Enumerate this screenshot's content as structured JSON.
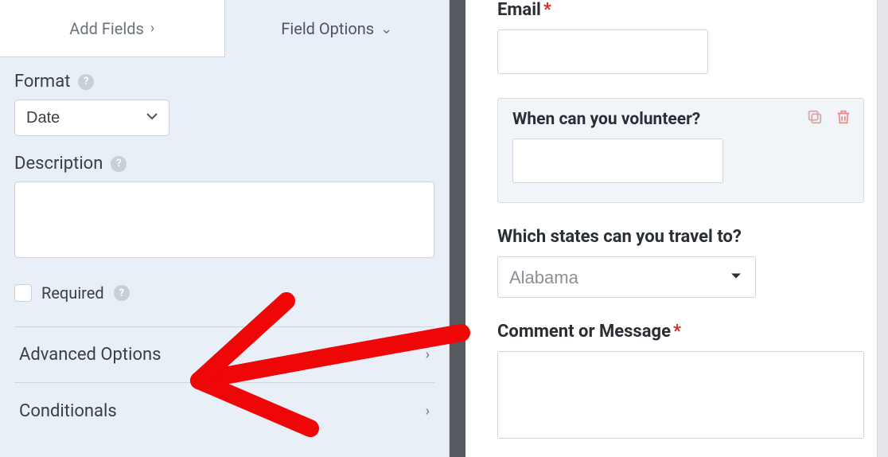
{
  "tabs": {
    "add_fields": "Add Fields",
    "field_options": "Field Options"
  },
  "left": {
    "format_label": "Format",
    "format_value": "Date",
    "description_label": "Description",
    "description_value": "",
    "required_label": "Required",
    "accordion": {
      "advanced": "Advanced Options",
      "conditionals": "Conditionals"
    }
  },
  "preview": {
    "email_label": "Email",
    "volunteer_label": "When can you volunteer?",
    "states_label": "Which states can you travel to?",
    "states_value": "Alabama",
    "comment_label": "Comment or Message"
  },
  "icons": {
    "help": "?",
    "chevron_right": "›",
    "chevron_down": "⌄",
    "required": "*"
  }
}
